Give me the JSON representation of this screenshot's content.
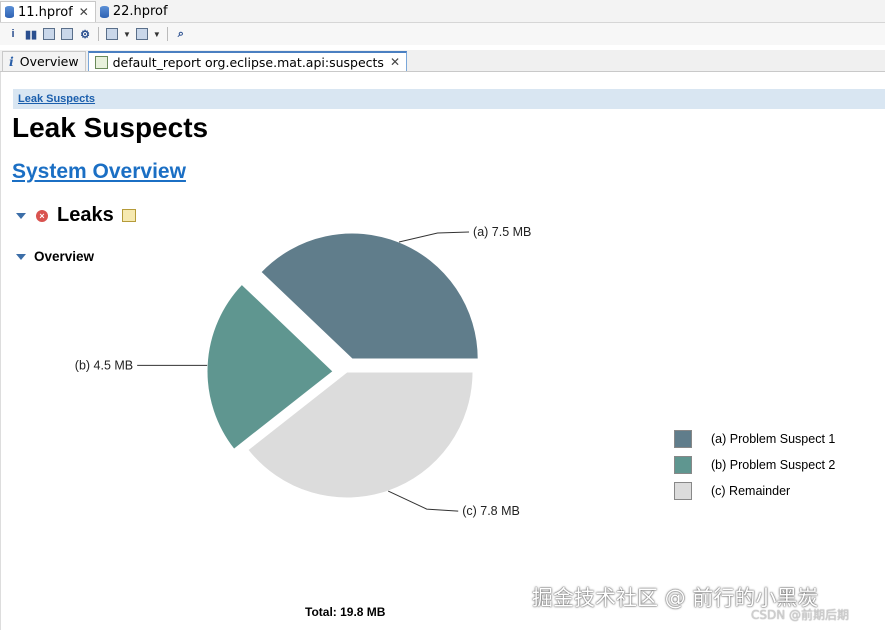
{
  "editor_tabs": [
    {
      "label": "11.hprof",
      "active": true,
      "closable": true
    },
    {
      "label": "22.hprof",
      "active": false,
      "closable": false
    }
  ],
  "toolbar": {
    "icons": [
      "info-icon",
      "histogram-icon",
      "dominator-tree-icon",
      "oql-icon",
      "thread-overview-icon",
      "run-report-icon",
      "query-browser-icon",
      "find-object-icon"
    ]
  },
  "report_tabs": [
    {
      "label": "Overview",
      "active": false
    },
    {
      "label": "default_report org.eclipse.mat.api:suspects",
      "active": true
    }
  ],
  "breadcrumb": "Leak Suspects",
  "page_title": "Leak Suspects",
  "system_overview_link": "System Overview",
  "leaks_heading": "Leaks",
  "overview_heading": "Overview",
  "chart_data": {
    "type": "pie",
    "unit": "MB",
    "slices": [
      {
        "label": "(a)  7.5 MB",
        "legend": "(a)  Problem Suspect 1",
        "value": 7.5,
        "color": "#607d8b",
        "exploded": true
      },
      {
        "label": "(b)  4.5 MB",
        "legend": "(b)  Problem Suspect 2",
        "value": 4.5,
        "color": "#5f9690",
        "exploded": true
      },
      {
        "label": "(c)  7.8 MB",
        "legend": "(c)  Remainder",
        "value": 7.8,
        "color": "#dcdcdc",
        "exploded": false
      }
    ],
    "total_label": "Total: 19.8 MB"
  },
  "watermark": "掘金技术社区 @ 前行的小黑炭",
  "csdn_mark": "CSDN @前期后期"
}
